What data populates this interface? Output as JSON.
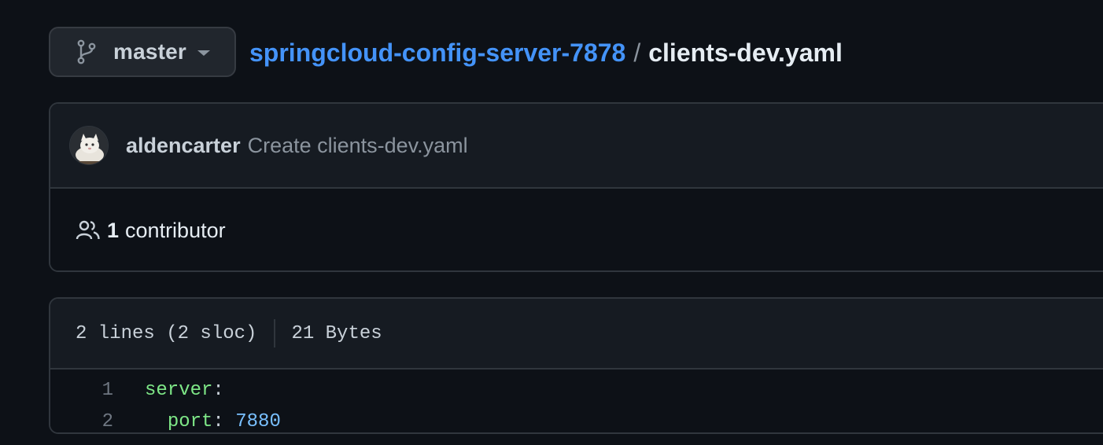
{
  "branch": {
    "icon": "git-branch-icon",
    "name": "master",
    "caret_icon": "triangle-down-icon"
  },
  "breadcrumb": {
    "repo": "springcloud-config-server-7878",
    "separator": "/",
    "file": "clients-dev.yaml"
  },
  "commit": {
    "avatar": "avatar-cat-image",
    "author": "aldencarter",
    "message": "Create clients-dev.yaml"
  },
  "contributors": {
    "icon": "people-icon",
    "count": "1",
    "label": "contributor"
  },
  "file_info": {
    "lines": "2 lines (2 sloc)",
    "size": "21 Bytes"
  },
  "code_lines": [
    {
      "number": "1",
      "indent": "",
      "key": "server",
      "colon": ":",
      "value": ""
    },
    {
      "number": "2",
      "indent": "  ",
      "key": "port",
      "colon": ":",
      "value": " 7880"
    }
  ],
  "colors": {
    "background": "#0d1117",
    "panel": "#161b22",
    "border": "#30363d",
    "link": "#4493f8",
    "yaml_key": "#7ee787",
    "yaml_number": "#79c0ff",
    "muted": "#8b949e"
  }
}
